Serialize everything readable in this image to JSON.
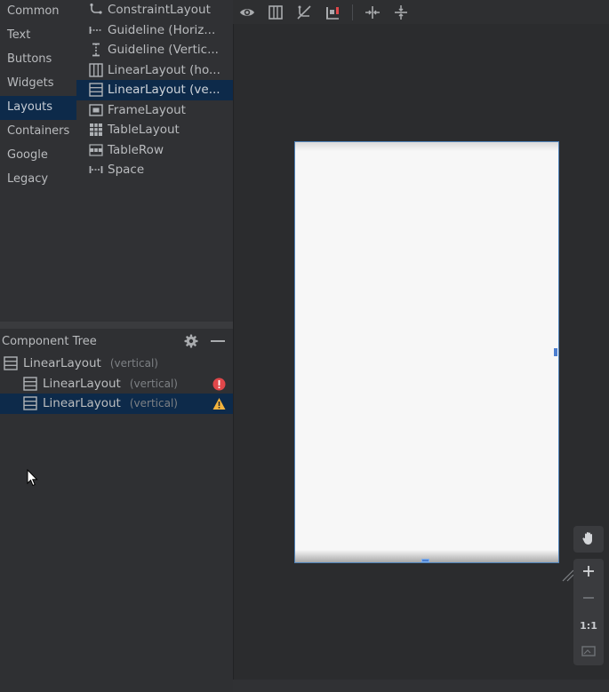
{
  "palette": {
    "categories": [
      "Common",
      "Text",
      "Buttons",
      "Widgets",
      "Layouts",
      "Containers",
      "Google",
      "Legacy"
    ],
    "selected_category": "Layouts",
    "items": [
      {
        "label": "ConstraintLayout",
        "icon": "constraint-layout-icon"
      },
      {
        "label": "Guideline (Horiz...",
        "icon": "guideline-horizontal-icon"
      },
      {
        "label": "Guideline (Vertic...",
        "icon": "guideline-vertical-icon"
      },
      {
        "label": "LinearLayout (ho...",
        "icon": "linear-layout-horizontal-icon"
      },
      {
        "label": "LinearLayout (ve...",
        "icon": "linear-layout-vertical-icon"
      },
      {
        "label": "FrameLayout",
        "icon": "frame-layout-icon"
      },
      {
        "label": "TableLayout",
        "icon": "table-layout-icon"
      },
      {
        "label": "TableRow",
        "icon": "table-row-icon"
      },
      {
        "label": "Space",
        "icon": "space-icon"
      }
    ],
    "selected_item": "LinearLayout (ve..."
  },
  "tree": {
    "title": "Component Tree",
    "nodes": [
      {
        "label": "LinearLayout",
        "sub": "(vertical)",
        "badge": ""
      },
      {
        "label": "LinearLayout",
        "sub": "(vertical)",
        "badge": "error"
      },
      {
        "label": "LinearLayout",
        "sub": "(vertical)",
        "badge": "warning"
      }
    ]
  },
  "toolbar": {
    "icons": [
      "eye-icon",
      "blueprint-icon",
      "constraints-off-icon",
      "infer-icon",
      "pack-horizontal-icon",
      "pack-vertical-icon"
    ]
  },
  "zoom": {
    "one_to_one": "1:1"
  },
  "colors": {
    "selection": "#0d2a4a",
    "accent": "#4c7fd0",
    "error": "#e0474a",
    "warning": "#f2b33d"
  }
}
